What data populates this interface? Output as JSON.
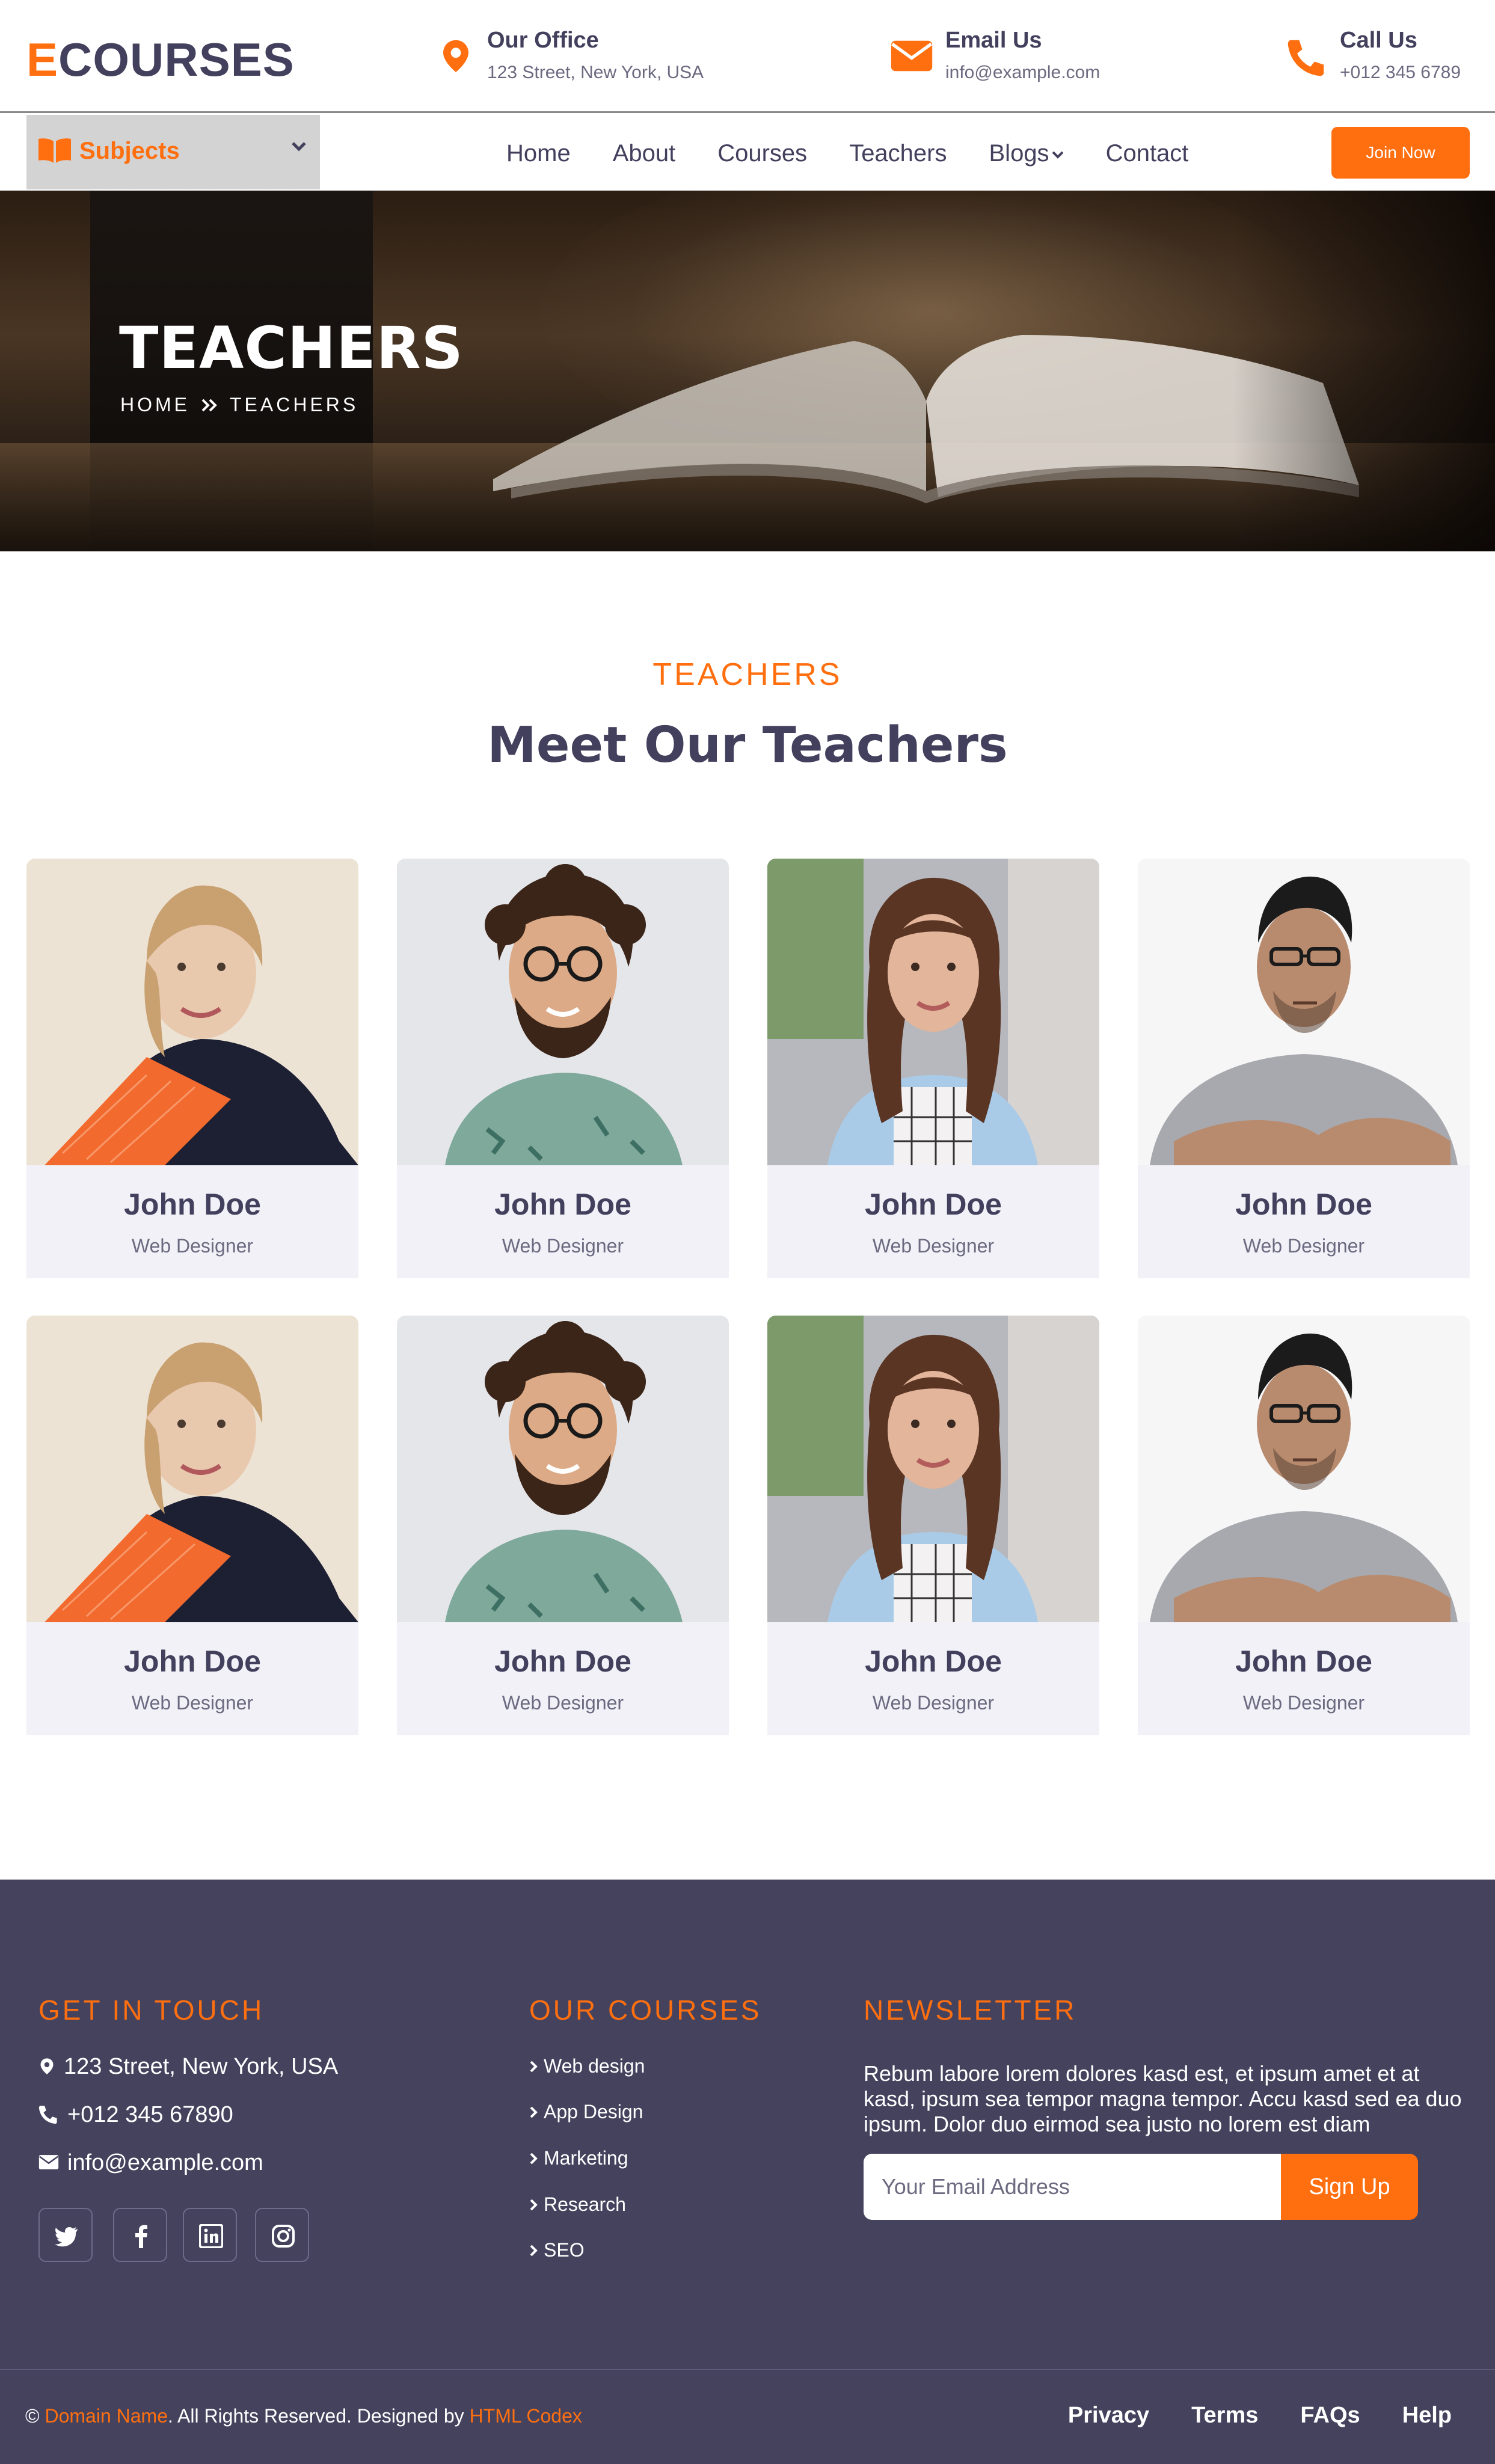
{
  "brand": {
    "first_letter": "E",
    "rest": "COURSES"
  },
  "contacts": {
    "office": {
      "title": "Our Office",
      "value": "123 Street, New York, USA"
    },
    "email": {
      "title": "Email Us",
      "value": "info@example.com"
    },
    "call": {
      "title": "Call Us",
      "value": "+012 345 6789"
    }
  },
  "nav": {
    "subjects_label": "Subjects",
    "links": [
      "Home",
      "About",
      "Courses",
      "Teachers",
      "Blogs",
      "Contact"
    ],
    "join_label": "Join Now"
  },
  "hero": {
    "title": "TEACHERS",
    "breadcrumb": [
      "HOME",
      "TEACHERS"
    ]
  },
  "section": {
    "label": "TEACHERS",
    "title": "Meet Our Teachers"
  },
  "teachers": [
    {
      "name": "John Doe",
      "role": "Web Designer",
      "photo": "woman-blonde-orange-folder"
    },
    {
      "name": "John Doe",
      "role": "Web Designer",
      "photo": "man-curly-hair-glasses"
    },
    {
      "name": "John Doe",
      "role": "Web Designer",
      "photo": "woman-brunette-long-hair"
    },
    {
      "name": "John Doe",
      "role": "Web Designer",
      "photo": "man-glasses-grey-tshirt"
    },
    {
      "name": "John Doe",
      "role": "Web Designer",
      "photo": "woman-blonde-orange-folder"
    },
    {
      "name": "John Doe",
      "role": "Web Designer",
      "photo": "man-curly-hair-glasses"
    },
    {
      "name": "John Doe",
      "role": "Web Designer",
      "photo": "woman-brunette-long-hair"
    },
    {
      "name": "John Doe",
      "role": "Web Designer",
      "photo": "man-glasses-grey-tshirt"
    }
  ],
  "footer": {
    "touch": {
      "heading": "GET IN TOUCH",
      "address": "123 Street, New York, USA",
      "phone": "+012 345 67890",
      "email": "info@example.com"
    },
    "social_icons": [
      "twitter-icon",
      "facebook-icon",
      "linkedin-icon",
      "instagram-icon"
    ],
    "courses": {
      "heading": "OUR COURSES",
      "items": [
        "Web design",
        "App Design",
        "Marketing",
        "Research",
        "SEO"
      ]
    },
    "newsletter": {
      "heading": "NEWSLETTER",
      "text": "Rebum labore lorem dolores kasd est, et ipsum amet et at kasd, ipsum sea tempor magna tempor. Accu kasd sed ea duo ipsum. Dolor duo eirmod sea justo no lorem est diam",
      "placeholder": "Your Email Address",
      "button": "Sign Up"
    },
    "copyright": {
      "symbol": "©",
      "domain": "Domain Name",
      "middle": ". All Rights Reserved. Designed by",
      "designer": "HTML Codex"
    },
    "bottom_links": [
      "Privacy",
      "Terms",
      "FAQs",
      "Help"
    ]
  },
  "colors": {
    "accent": "#ff6f0f",
    "dark": "#43405d",
    "footer_bg": "#45425e",
    "card_bg": "#f1f1f7"
  }
}
